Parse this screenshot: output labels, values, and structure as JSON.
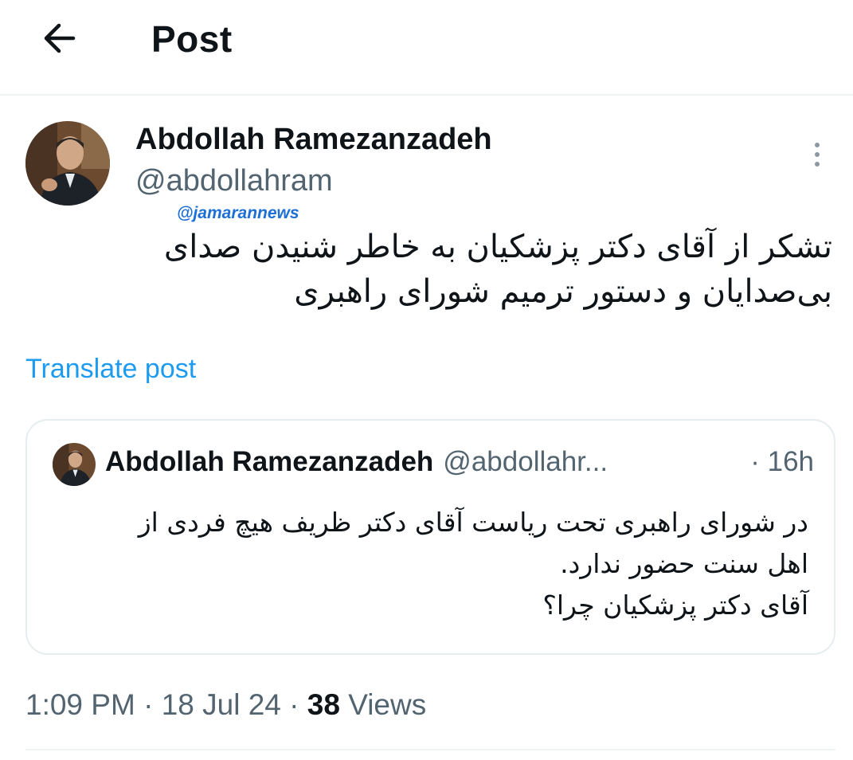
{
  "header": {
    "title": "Post",
    "back_icon": "arrow-left-icon"
  },
  "post": {
    "author": {
      "name": "Abdollah Ramezanzadeh",
      "handle": "@abdollahram"
    },
    "more_icon": "more-vertical-icon",
    "watermark": "@jamarannews",
    "text_lines": [
      "تشکر از آقای دکتر پزشکیان به خاطر شنیدن صدای",
      "بی‌صدایان و دستور ترمیم شورای راهبری"
    ],
    "translate_label": "Translate post",
    "quoted": {
      "name": "Abdollah Ramezanzadeh",
      "handle": "@abdollahr...",
      "time": "· 16h",
      "text_lines": [
        "در شورای راهبری تحت ریاست آقای دکتر ظریف هیچ فردی از",
        "اهل سنت حضور ندارد.",
        "آقای دکتر پزشکیان چرا؟"
      ]
    },
    "meta": {
      "time": "1:09 PM",
      "date": "18 Jul 24",
      "separator": "·",
      "views_count": "38",
      "views_label": "Views"
    }
  },
  "colors": {
    "accent": "#1d9bf0",
    "secondary_text": "#536471",
    "primary_text": "#0f1419",
    "border": "#eff3f4",
    "watermark": "#1d6fd6"
  }
}
